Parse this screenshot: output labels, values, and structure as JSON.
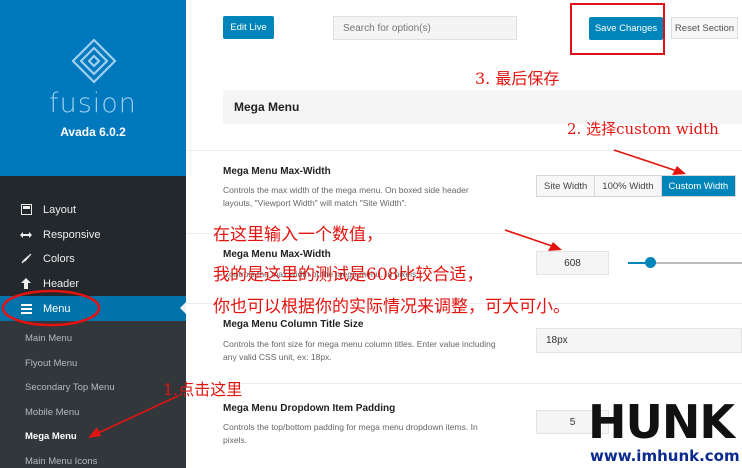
{
  "sidebar": {
    "brand": "fusion",
    "version": "Avada 6.0.2",
    "items": [
      {
        "label": "Layout",
        "icon": "layout-icon"
      },
      {
        "label": "Responsive",
        "icon": "arrows-horizontal-icon"
      },
      {
        "label": "Colors",
        "icon": "brush-icon"
      },
      {
        "label": "Header",
        "icon": "arrow-up-icon"
      },
      {
        "label": "Menu",
        "icon": "menu-icon"
      }
    ],
    "subitems": [
      "Main Menu",
      "Flyout Menu",
      "Secondary Top Menu",
      "Mobile Menu",
      "Mega Menu",
      "Main Menu Icons"
    ]
  },
  "toolbar": {
    "edit_live": "Edit Live",
    "search_placeholder": "Search for option(s)",
    "save": "Save Changes",
    "reset": "Reset Section"
  },
  "section": {
    "title": "Mega Menu"
  },
  "settings": {
    "max_width": {
      "title": "Mega Menu Max-Width",
      "desc": "Controls the max width of the mega menu. On boxed side header layouts, \"Viewport Width\" will match \"Site Width\".",
      "options": [
        "Site Width",
        "100% Width",
        "Custom Width"
      ],
      "selected": "Custom Width"
    },
    "max_width_px": {
      "title": "Mega Menu Max-Width",
      "desc": "Controls the max width of the mega menu. In pixels.",
      "value": "608",
      "slider_fraction": 0.2
    },
    "column_title": {
      "title": "Mega Menu Column Title Size",
      "desc": "Controls the font size for mega menu column titles. Enter value including any valid CSS unit, ex: 18px.",
      "value": "18px"
    },
    "dropdown_padding": {
      "title": "Mega Menu Dropdown Item Padding",
      "desc": "Controls the top/bottom padding for mega menu dropdown items. In pixels.",
      "value": "5"
    }
  },
  "annotations": {
    "step3": "3. 最后保存",
    "step2": "2. 选择custom width",
    "note1": "在这里输入一个数值，",
    "note2": "我的是这里的测试是608比较合适，",
    "note3": "你也可以根据你的实际情况来调整，可大可小。",
    "step1": "1.点击这里"
  },
  "watermark": {
    "word": "HUNK",
    "url": "www.imhunk.com"
  },
  "colors": {
    "accent": "#0085ba",
    "sidebar": "#23282d",
    "brand": "#0078be",
    "annotation": "#e3140f"
  }
}
